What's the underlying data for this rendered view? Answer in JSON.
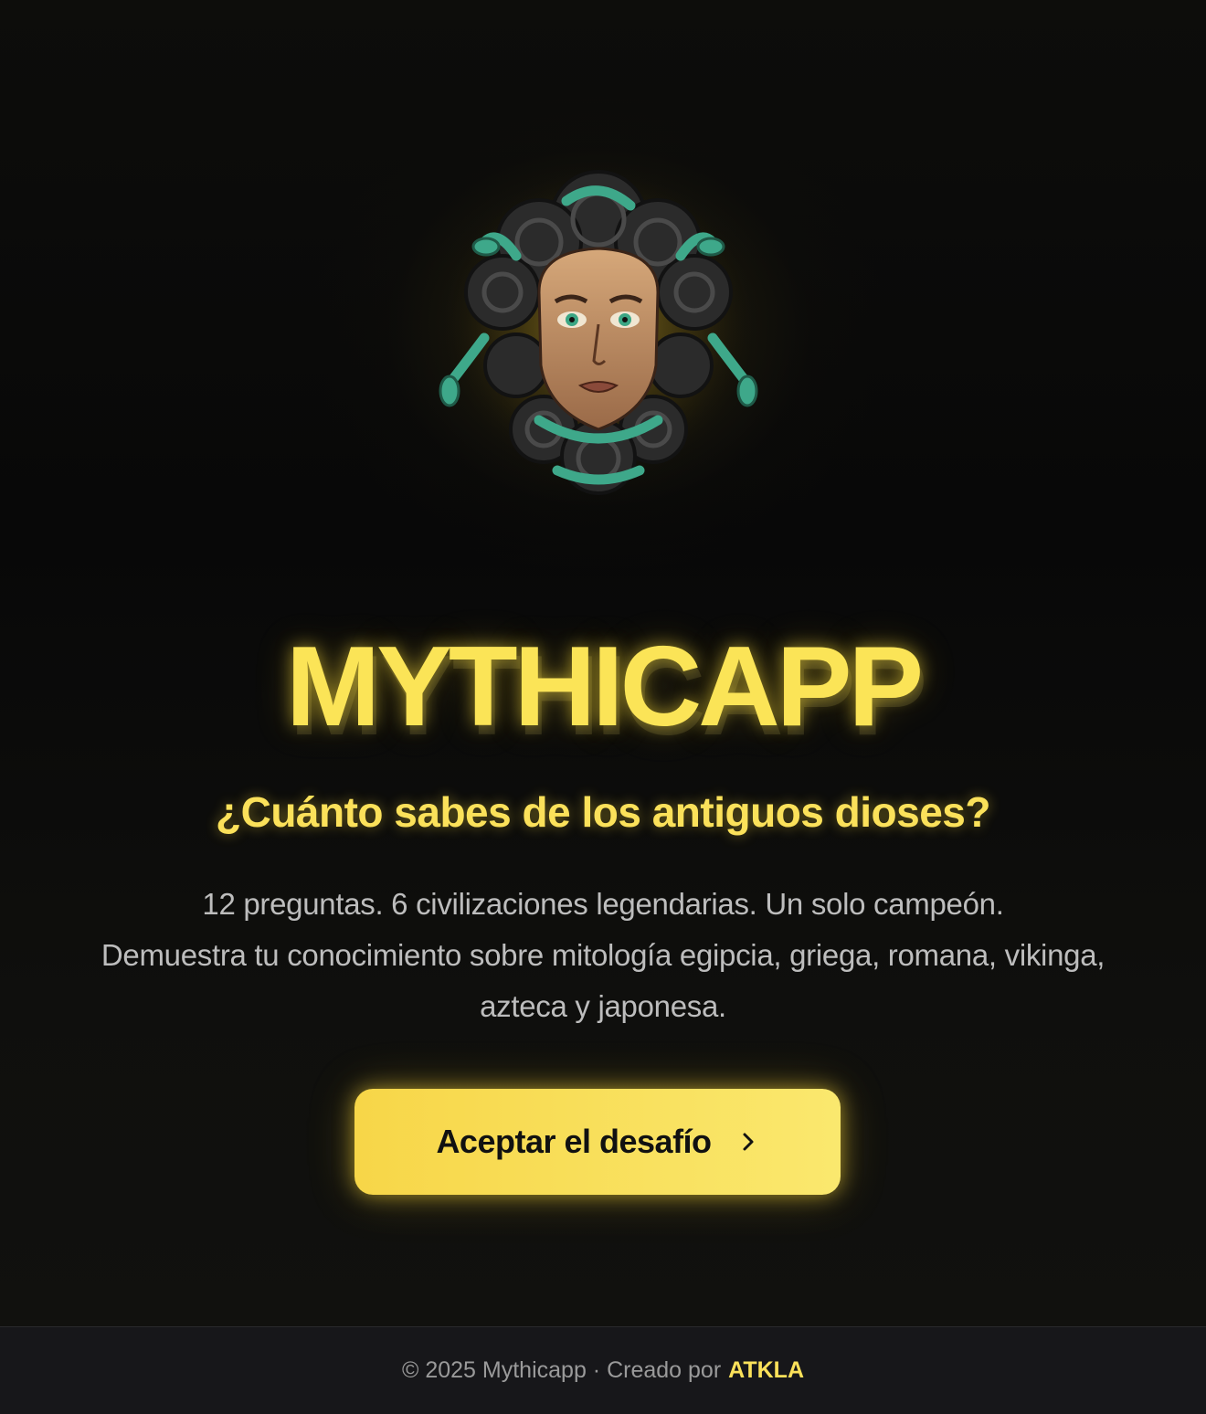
{
  "hero": {
    "logo_icon": "medusa-head-icon",
    "brand": "MYTHICAPP",
    "subtitle": "¿Cuánto sabes de los antiguos dioses?",
    "description": [
      "12 preguntas. 6 civilizaciones legendarias. Un solo campeón.",
      "Demuestra tu conocimiento sobre mitología egipcia, griega, romana, vikinga,",
      "azteca y japonesa."
    ],
    "cta_label": "Aceptar el desafío",
    "cta_icon": "chevron-right-icon"
  },
  "footer": {
    "copyright": "© 2025 Mythicapp · Creado por",
    "author": "ATKLA"
  },
  "colors": {
    "accent": "#fbe457",
    "background": "#0b0b09",
    "footer_bg": "#17171a"
  }
}
